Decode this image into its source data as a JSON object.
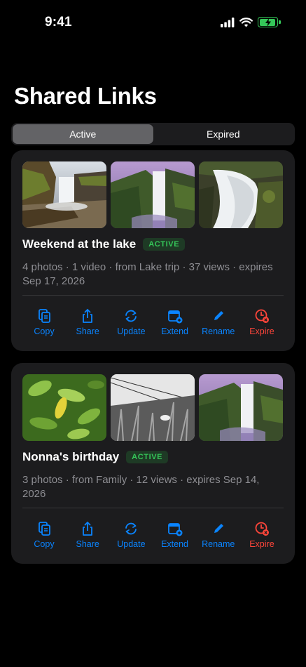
{
  "status": {
    "time": "9:41"
  },
  "header": {
    "title": "Shared Links"
  },
  "segments": [
    {
      "label": "Active",
      "selected": true
    },
    {
      "label": "Expired",
      "selected": false
    }
  ],
  "cards": [
    {
      "title": "Weekend at the lake",
      "badge": "ACTIVE",
      "meta": "4 photos · 1 video · from Lake trip · 37 views · expires Sep 17, 2026",
      "thumbnails": [
        "waterfall-canyon-photo",
        "waterfall-cliff-photo",
        "waterfall-closeup-photo"
      ],
      "actions": [
        "Copy",
        "Share",
        "Update",
        "Extend",
        "Rename",
        "Expire"
      ]
    },
    {
      "title": "Nonna's birthday",
      "badge": "ACTIVE",
      "meta": "3 photos · from Family · 12 views · expires Sep 14, 2026",
      "thumbnails": [
        "green-leaves-photo",
        "grass-bw-photo",
        "waterfall-cliff-photo"
      ],
      "actions": [
        "Copy",
        "Share",
        "Update",
        "Extend",
        "Rename",
        "Expire"
      ]
    }
  ],
  "colors": {
    "accent": "#0a84ff",
    "danger": "#ff453a",
    "active": "#35c759",
    "card": "#1c1c1e"
  }
}
